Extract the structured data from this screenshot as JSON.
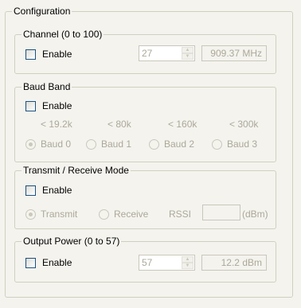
{
  "configuration": {
    "legend": "Configuration",
    "channel": {
      "legend": "Channel (0 to 100)",
      "enable_label": "Enable",
      "enabled": false,
      "spin_value": "27",
      "frequency": "909.37 MHz"
    },
    "baud_band": {
      "legend": "Baud Band",
      "enable_label": "Enable",
      "enabled": false,
      "rate_labels": [
        "< 19.2k",
        "< 80k",
        "< 160k",
        "< 300k"
      ],
      "options": [
        "Baud 0",
        "Baud 1",
        "Baud 2",
        "Baud 3"
      ],
      "selected": "Baud 0"
    },
    "mode": {
      "legend": "Transmit / Receive Mode",
      "enable_label": "Enable",
      "enabled": false,
      "options": [
        "Transmit",
        "Receive"
      ],
      "selected": "Transmit",
      "rssi_label": "RSSI",
      "rssi_value": "",
      "rssi_unit": "(dBm)"
    },
    "output_power": {
      "legend": "Output Power (0 to 57)",
      "enable_label": "Enable",
      "enabled": false,
      "spin_value": "57",
      "power": "12.2 dBm"
    }
  },
  "icons": {
    "spin_up": "▲",
    "spin_down": "▼"
  }
}
